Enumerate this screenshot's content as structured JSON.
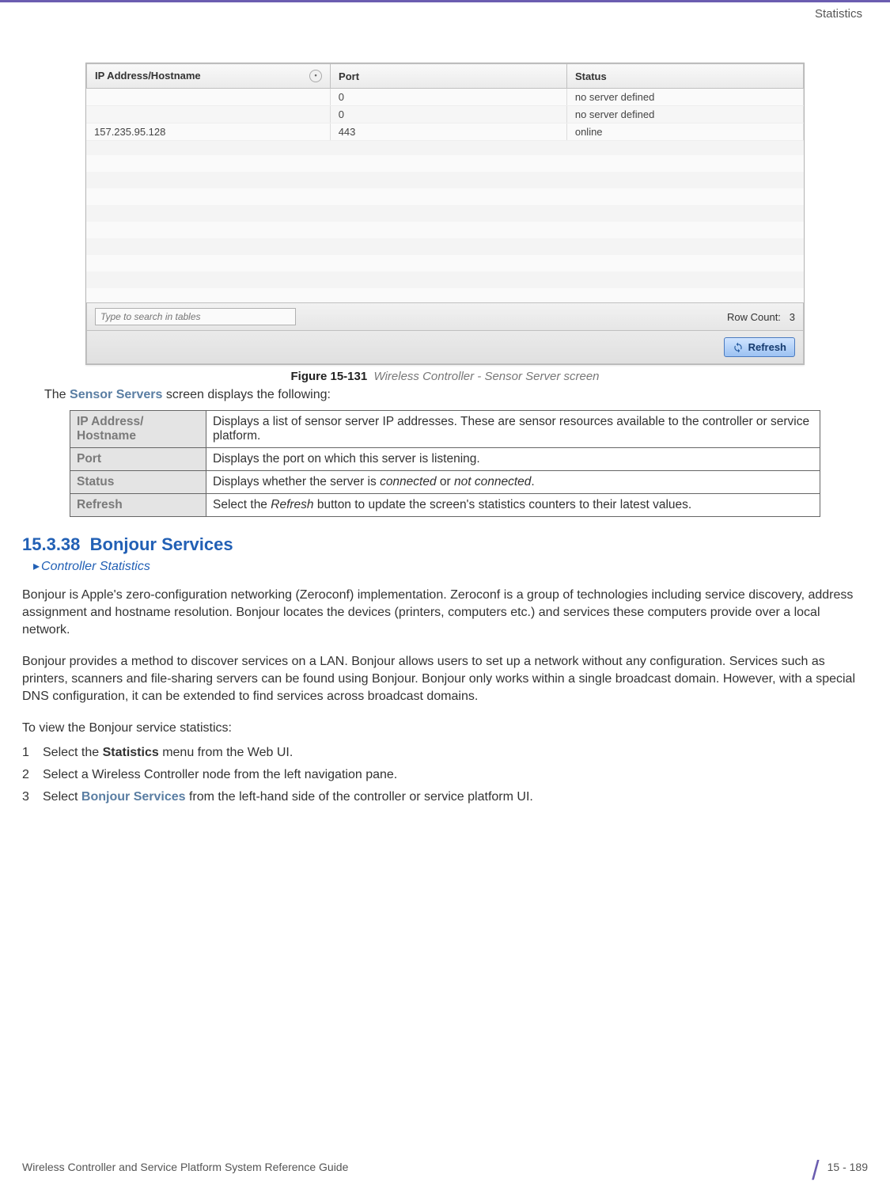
{
  "header": {
    "section": "Statistics"
  },
  "panel": {
    "columns": {
      "ip": "IP Address/Hostname",
      "port": "Port",
      "status": "Status"
    },
    "rows": [
      {
        "ip": "",
        "port": "0",
        "status": "no server defined"
      },
      {
        "ip": "",
        "port": "0",
        "status": "no server defined"
      },
      {
        "ip": "157.235.95.128",
        "port": "443",
        "status": "online"
      }
    ],
    "search_placeholder": "Type to search in tables",
    "row_count_label": "Row Count:",
    "row_count_value": "3",
    "refresh_label": "Refresh"
  },
  "figure": {
    "label_bold": "Figure 15-131",
    "label_ital": "Wireless Controller - Sensor Server screen"
  },
  "intro": {
    "pre": "The ",
    "bold": "Sensor Servers",
    "post": " screen displays the following:"
  },
  "desc_table": [
    {
      "label": "IP Address/\nHostname",
      "desc": "Displays a list of sensor server IP addresses. These are sensor resources available to the controller or service platform."
    },
    {
      "label": "Port",
      "desc": "Displays the port on which this server is listening."
    },
    {
      "label": "Status",
      "desc_pre": "Displays whether the server is ",
      "desc_i1": "connected",
      "desc_mid": " or ",
      "desc_i2": "not connected",
      "desc_post": "."
    },
    {
      "label": "Refresh",
      "desc_pre": "Select the ",
      "desc_i1": "Refresh",
      "desc_post": " button to update the screen's statistics counters to their latest values."
    }
  ],
  "section": {
    "number": "15.3.38",
    "title": "Bonjour Services",
    "link": "Controller Statistics"
  },
  "paras": {
    "p1": "Bonjour is Apple's zero-configuration networking (Zeroconf) implementation. Zeroconf is a group of technologies including service discovery, address assignment and hostname resolution. Bonjour locates the devices (printers, computers etc.) and services these computers provide over a local network.",
    "p2": "Bonjour provides a method to discover services on a LAN. Bonjour allows users to set up a network without any configuration. Services such as printers, scanners and file-sharing servers can be found using Bonjour. Bonjour only works within a single broadcast domain. However, with a special DNS configuration, it can be extended to find services across broadcast domains.",
    "p3": "To view the Bonjour service statistics:"
  },
  "steps": {
    "s1_pre": "Select the ",
    "s1_bold": "Statistics",
    "s1_post": " menu from the Web UI.",
    "s2": "Select a Wireless Controller node from the left navigation pane.",
    "s3_pre": "Select ",
    "s3_bold": "Bonjour Services",
    "s3_post": " from the left-hand side of the controller or service platform UI."
  },
  "footer": {
    "guide": "Wireless Controller and Service Platform System Reference Guide",
    "pagenum": "15 - 189"
  }
}
